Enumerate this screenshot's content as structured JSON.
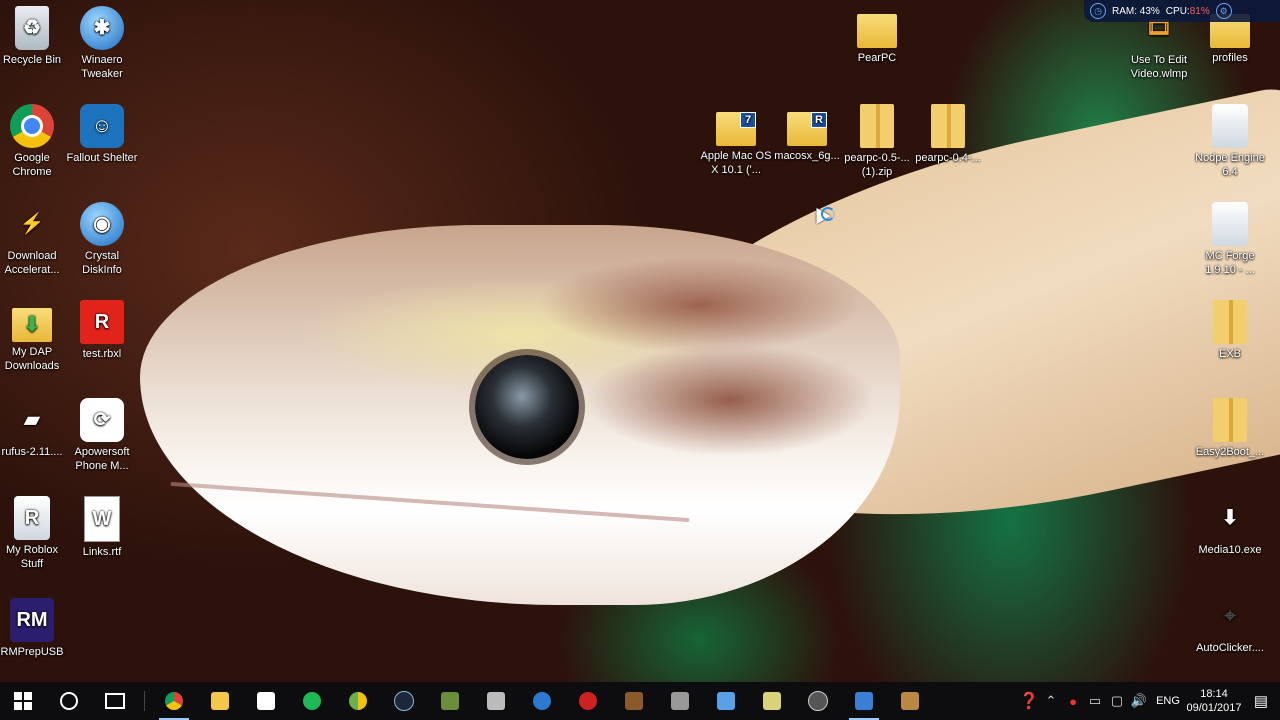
{
  "desktop_left_icons": [
    {
      "label": "Recycle Bin",
      "icon": "recycle-bin-icon"
    },
    {
      "label": "Winaero Tweaker",
      "icon": "winaero-tweaker-icon"
    },
    {
      "label": "Google Chrome",
      "icon": "chrome-icon"
    },
    {
      "label": "Fallout Shelter",
      "icon": "fallout-shelter-icon"
    },
    {
      "label": "Download Accelerat...",
      "icon": "download-accelerator-icon"
    },
    {
      "label": "Crystal DiskInfo",
      "icon": "crystal-diskinfo-icon"
    },
    {
      "label": "My DAP Downloads",
      "icon": "dap-downloads-folder-icon"
    },
    {
      "label": "test.rbxl",
      "icon": "roblox-file-icon"
    },
    {
      "label": "rufus-2.11....",
      "icon": "rufus-icon"
    },
    {
      "label": "Apowersoft Phone M...",
      "icon": "apowersoft-icon"
    },
    {
      "label": "My Roblox Stuff",
      "icon": "roblox-folder-icon"
    },
    {
      "label": "Links.rtf",
      "icon": "word-document-icon"
    },
    {
      "label": "RMPrepUSB",
      "icon": "rmprepusb-icon"
    }
  ],
  "desktop_middle_icons": [
    {
      "label": "PearPC",
      "icon": "folder-icon"
    },
    {
      "label": "Apple Mac OS X 10.1 ('...",
      "icon": "7zip-archive-icon",
      "badge": "7"
    },
    {
      "label": "macosx_6g...",
      "icon": "rar-archive-icon",
      "badge": "R"
    },
    {
      "label": "pearpc-0.5-... (1).zip",
      "icon": "zip-folder-icon"
    },
    {
      "label": "pearpc-0.4-...",
      "icon": "zip-folder-icon"
    }
  ],
  "desktop_right_icons": [
    {
      "label": "Use To Edit Video.wlmp",
      "icon": "movie-maker-icon"
    },
    {
      "label": "profiles",
      "icon": "folder-icon"
    },
    {
      "label": "Nodpe Engine 6.4",
      "icon": "document-icon"
    },
    {
      "label": "MC Forge 1.9.10 - ...",
      "icon": "document-icon"
    },
    {
      "label": "EXB",
      "icon": "zip-folder-icon"
    },
    {
      "label": "Easy2Boot_...",
      "icon": "zip-folder-icon"
    },
    {
      "label": "Media10.exe",
      "icon": "media-installer-icon"
    },
    {
      "label": "AutoClicker....",
      "icon": "autoclicker-icon"
    }
  ],
  "system_monitor": {
    "ram_label": "RAM: 43%",
    "cpu_label": "CPU: ",
    "cpu_value": "81%"
  },
  "taskbar": {
    "start_label": "Start",
    "pinned": [
      "chrome-icon",
      "file-explorer-icon",
      "store-icon",
      "spotify-icon",
      "chrome-canary-icon",
      "steam-icon",
      "minecraft-icon",
      "tool-icon",
      "ccleaner-icon",
      "red-app-icon",
      "minecraft-block-icon",
      "game-icon",
      "cube-icon",
      "terminal-icon",
      "virtualbox-icon",
      "mail-icon",
      "winrar-icon"
    ],
    "tray": {
      "language": "ENG",
      "time": "18:14",
      "date": "09/01/2017"
    }
  },
  "colors": {
    "taskbar_bg": "#0d0d0f",
    "cpu_value": "#ff5a5a",
    "cursor_ring": "#2b8de0"
  }
}
